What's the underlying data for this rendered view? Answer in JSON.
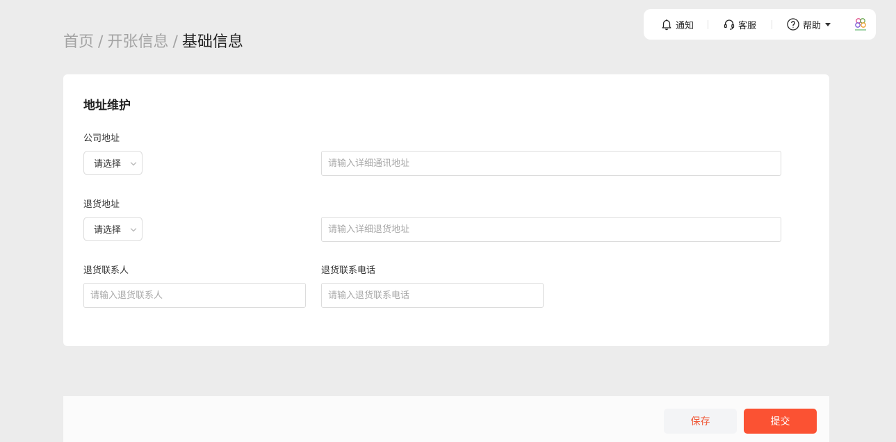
{
  "breadcrumb": {
    "items": [
      "首页",
      "开张信息",
      "基础信息"
    ],
    "separator": "/"
  },
  "toolbar": {
    "notify_label": "通知",
    "service_label": "客服",
    "help_label": "帮助",
    "icons": [
      "bell-icon",
      "headset-icon",
      "question-icon",
      "chevron-down-icon",
      "avatar-logo"
    ]
  },
  "section": {
    "title": "地址维护"
  },
  "company_address": {
    "label": "公司地址",
    "select_value": "请选择",
    "detail_placeholder": "请输入详细通讯地址"
  },
  "return_address": {
    "label": "退货地址",
    "select_value": "请选择",
    "detail_placeholder": "请输入详细退货地址"
  },
  "return_contact": {
    "label": "退货联系人",
    "placeholder": "请输入退货联系人"
  },
  "return_phone": {
    "label": "退货联系电话",
    "placeholder": "请输入退货联系电话"
  },
  "footer": {
    "save_label": "保存",
    "submit_label": "提交"
  },
  "colors": {
    "accent": "#fb5233",
    "background": "#ececec",
    "card": "#ffffff"
  }
}
